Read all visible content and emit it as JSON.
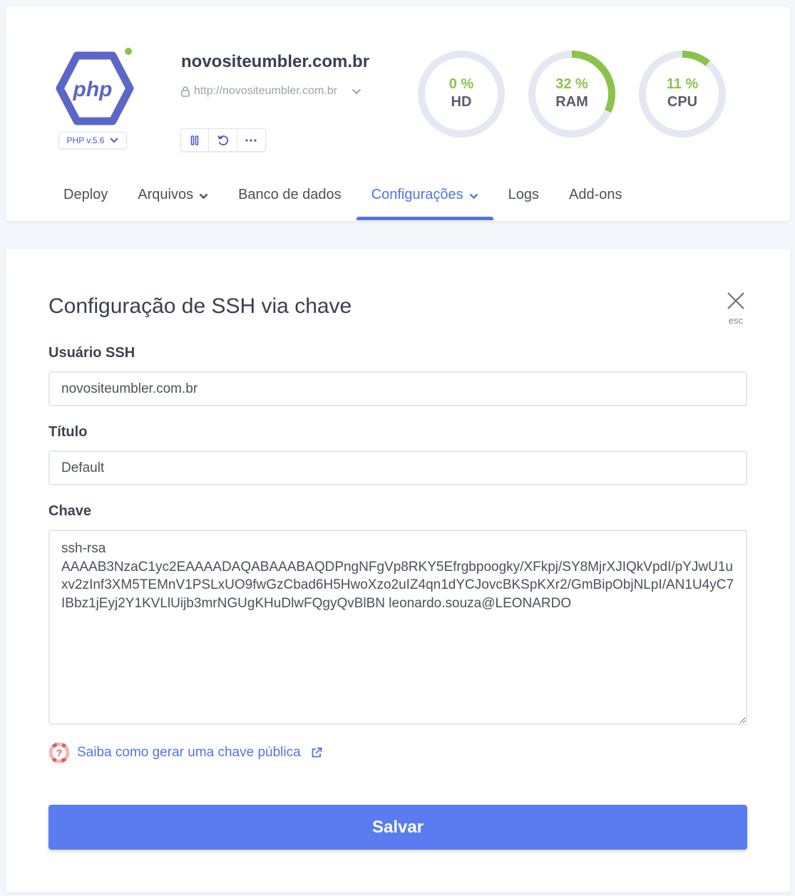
{
  "app": {
    "site_name": "novositeumbler.com.br",
    "site_url": "http://novositeumbler.com.br",
    "php_version": "PHP v.5.6",
    "logo_text": "php",
    "status_color": "#8bc34a"
  },
  "actions": [
    {
      "icon": "pause-icon"
    },
    {
      "icon": "restart-icon"
    },
    {
      "icon": "more-icon"
    }
  ],
  "gauges": [
    {
      "value_label": "0 %",
      "label": "HD",
      "value": 0
    },
    {
      "value_label": "32 %",
      "label": "RAM",
      "value": 32
    },
    {
      "value_label": "11 %",
      "label": "CPU",
      "value": 11
    }
  ],
  "nav": {
    "items": [
      {
        "label": "Deploy",
        "has_dropdown": false,
        "active": false
      },
      {
        "label": "Arquivos",
        "has_dropdown": true,
        "active": false
      },
      {
        "label": "Banco de dados",
        "has_dropdown": false,
        "active": false
      },
      {
        "label": "Configurações",
        "has_dropdown": true,
        "active": true
      },
      {
        "label": "Logs",
        "has_dropdown": false,
        "active": false
      },
      {
        "label": "Add-ons",
        "has_dropdown": false,
        "active": false
      }
    ]
  },
  "form": {
    "title": "Configuração de SSH via chave",
    "close_hint": "esc",
    "ssh_user_label": "Usuário SSH",
    "ssh_user_value": "novositeumbler.com.br",
    "title_label": "Título",
    "title_value": "Default",
    "key_label": "Chave",
    "key_value": "ssh-rsa\nAAAAB3NzaC1yc2EAAAADAQABAAABAQDPngNFgVp8RKY5Efrgbpoogky/XFkpj/SY8MjrXJIQkVpdI/pYJwU1uxv2zInf3XM5TEMnV1PSLxUO9fwGzCbad6H5HwoXzo2uIZ4qn1dYCJovcBKSpKXr2/GmBipObjNLpI/AN1U4yC7IBbz1jEyj2Y1KVLlUijb3mrNGUgKHuDlwFQgyQvBlBN leonardo.souza@LEONARDO",
    "help_link": "Saiba como gerar uma chave pública",
    "save_label": "Salvar"
  },
  "colors": {
    "accent": "#5473e8",
    "button": "#5a7cf0",
    "gauge_fill": "#8bc34a",
    "gauge_track": "#e3e8f3",
    "logo": "#5b67c7"
  }
}
